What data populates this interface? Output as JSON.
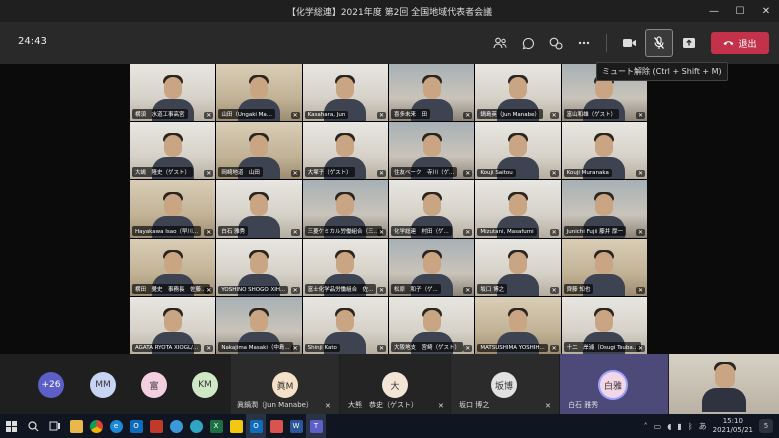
{
  "window": {
    "title": "【化学総連】2021年度 第2回 全国地域代表者会議",
    "controls": [
      "—",
      "☐",
      "✕"
    ]
  },
  "toolbar": {
    "timer": "24:43",
    "leave_label": "退出",
    "tooltip": "ミュート解除 (Ctrl + Shift + M)",
    "icons": [
      "people-icon",
      "chat-icon",
      "reactions-icon",
      "more-icon",
      "camera-icon",
      "mic-off-icon",
      "share-icon"
    ]
  },
  "participants": [
    {
      "name": "横須　水道工事高宮",
      "bg": "alt1"
    },
    {
      "name": "山田（Ungaki Ma...",
      "bg": "alt3"
    },
    {
      "name": "Kasahara, Jun",
      "bg": "alt1"
    },
    {
      "name": "喜多未来　田",
      "bg": "alt2"
    },
    {
      "name": "鍋島英（Jun Manabe）",
      "bg": "alt1"
    },
    {
      "name": "富山和雄（ゲスト）",
      "bg": "alt2"
    },
    {
      "name": "大嶋　隆史（ゲスト）",
      "bg": "alt1"
    },
    {
      "name": "岡崎地道　山田",
      "bg": "alt3"
    },
    {
      "name": "大塚子（ゲスト）",
      "bg": "alt1"
    },
    {
      "name": "住友ベーク　寺川（ゲ...",
      "bg": "alt2"
    },
    {
      "name": "Kouji Saitou",
      "bg": "alt1"
    },
    {
      "name": "Kouji Muranaka",
      "bg": "alt1"
    },
    {
      "name": "Hayakawa Isao（早川...",
      "bg": "alt3"
    },
    {
      "name": "白石 雅秀",
      "bg": "alt1"
    },
    {
      "name": "三菱ケミカル労働組合（三...",
      "bg": "alt2"
    },
    {
      "name": "化学総連　村田（ゲ...",
      "bg": "alt1"
    },
    {
      "name": "Mizutani, Masafumi",
      "bg": "alt1"
    },
    {
      "name": "Junichi Fujii 藤井 厚一",
      "bg": "alt2"
    },
    {
      "name": "横田　覺史　事務長　佐藤（...",
      "bg": "alt3"
    },
    {
      "name": "YOSHINO SHOGO XIH...",
      "bg": "alt1"
    },
    {
      "name": "富士化学品労働組合　佐...",
      "bg": "alt1"
    },
    {
      "name": "松原　和子（ゲ...",
      "bg": "alt2"
    },
    {
      "name": "坂口 博之",
      "bg": "alt1"
    },
    {
      "name": "齊藤 知也",
      "bg": "alt3"
    },
    {
      "name": "AGATA RYOTA XIOGL/...",
      "bg": "alt1"
    },
    {
      "name": "Nakajima Masaki（中島...",
      "bg": "alt2"
    },
    {
      "name": "Shinji Kato",
      "bg": "alt1"
    },
    {
      "name": "大阪地支　宮崎（ゲスト）",
      "bg": "alt1"
    },
    {
      "name": "MATSUSHIMA YOSHIH...",
      "bg": "alt3"
    },
    {
      "name": "十二　岸浦（Osugi Tsuba...",
      "bg": "alt1"
    }
  ],
  "bottom": {
    "overflow_count": "+26",
    "chips": [
      {
        "initials": "MM",
        "color": "#c7d4f4"
      },
      {
        "initials": "富",
        "color": "#f4cfe0"
      },
      {
        "initials": "KM",
        "color": "#cfe8c5"
      }
    ],
    "tiles": [
      {
        "initials": "眞M",
        "name": "眞鍋潤（Jun Manabe）",
        "color": "#f5e0c8"
      },
      {
        "initials": "大",
        "name": "大熊　恭史（ゲスト）",
        "color": "#f3e5d6"
      },
      {
        "initials": "坂博",
        "name": "坂口 博之",
        "color": "#e2e2e2"
      },
      {
        "initials": "白雅",
        "name": "白石 雅秀",
        "color": "#f4d7e6"
      }
    ]
  },
  "taskbar": {
    "time": "15:10",
    "date": "2021/05/21",
    "notif_count": "5"
  }
}
